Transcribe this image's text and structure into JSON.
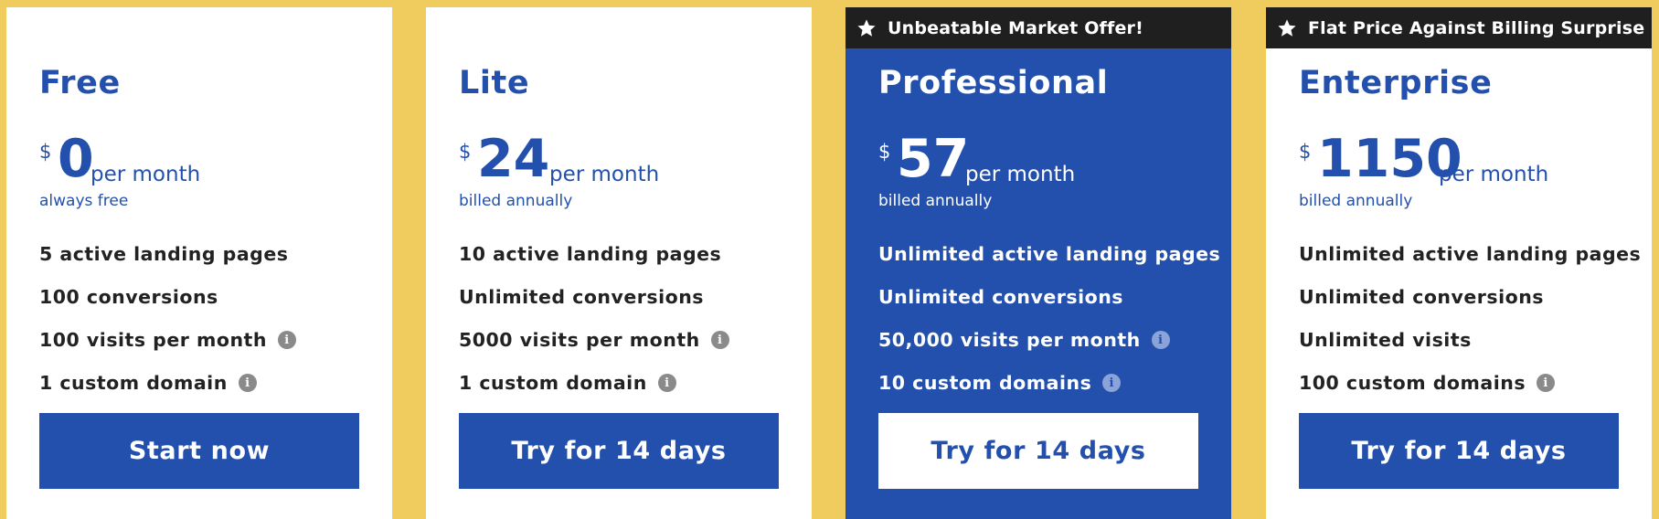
{
  "currency_symbol": "$",
  "period_label": "per month",
  "plans": [
    {
      "name": "Free",
      "banner": "",
      "price": "0",
      "billing": "always free",
      "features": [
        {
          "text": "5 active landing pages",
          "info": false
        },
        {
          "text": "100 conversions",
          "info": false
        },
        {
          "text": "100 visits per month",
          "info": true
        },
        {
          "text": "1 custom domain",
          "info": true
        }
      ],
      "cta": "Start now"
    },
    {
      "name": "Lite",
      "banner": "",
      "price": "24",
      "billing": "billed annually",
      "features": [
        {
          "text": "10 active landing pages",
          "info": false
        },
        {
          "text": "Unlimited conversions",
          "info": false
        },
        {
          "text": "5000 visits per month",
          "info": true
        },
        {
          "text": "1 custom domain",
          "info": true
        }
      ],
      "cta": "Try for 14 days"
    },
    {
      "name": "Professional",
      "banner": "Unbeatable Market Offer!",
      "price": "57",
      "billing": "billed annually",
      "features": [
        {
          "text": "Unlimited active landing pages",
          "info": false
        },
        {
          "text": "Unlimited conversions",
          "info": false
        },
        {
          "text": "50,000 visits per month",
          "info": true
        },
        {
          "text": "10 custom domains",
          "info": true
        }
      ],
      "cta": "Try for 14 days"
    },
    {
      "name": "Enterprise",
      "banner": "Flat Price Against Billing Surprise",
      "price": "1150",
      "billing": "billed annually",
      "features": [
        {
          "text": "Unlimited active landing pages",
          "info": false
        },
        {
          "text": "Unlimited conversions",
          "info": false
        },
        {
          "text": "Unlimited visits",
          "info": false
        },
        {
          "text": "100 custom domains",
          "info": true
        }
      ],
      "cta": "Try for 14 days"
    }
  ],
  "info_icon_glyph": "i",
  "icons": {
    "banner": "star-icon",
    "feature_info": "info-icon"
  },
  "colors": {
    "background": "#f0cb5e",
    "brand_blue": "#2350ad",
    "banner_black": "#1f1f1f",
    "info_gray": "#8a8a8a"
  }
}
